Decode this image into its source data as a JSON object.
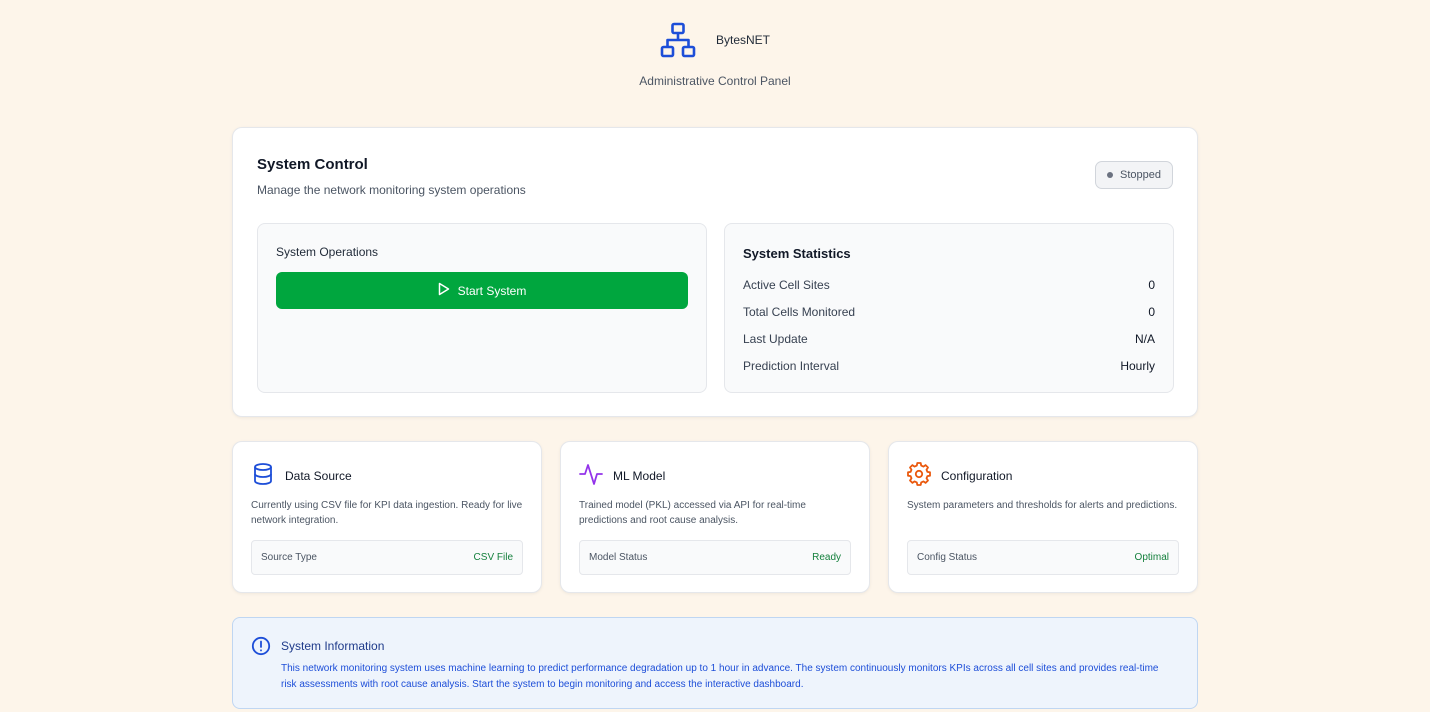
{
  "header": {
    "brand": "BytesNET",
    "subtitle": "Administrative Control Panel",
    "logo_icon": "network-hierarchy-icon",
    "accent_color": "#1d4ed8"
  },
  "system_control": {
    "title": "System Control",
    "description": "Manage the network monitoring system operations",
    "status": "Stopped",
    "operations": {
      "title": "System Operations",
      "start_button": "Start System",
      "button_color": "#00a63e"
    },
    "statistics": {
      "title": "System Statistics",
      "rows": [
        {
          "label": "Active Cell Sites",
          "value": "0"
        },
        {
          "label": "Total Cells Monitored",
          "value": "0"
        },
        {
          "label": "Last Update",
          "value": "N/A"
        },
        {
          "label": "Prediction Interval",
          "value": "Hourly"
        }
      ]
    }
  },
  "cards": [
    {
      "icon": "database-icon",
      "title": "Data Source",
      "description": "Currently using CSV file for KPI data ingestion. Ready for live network integration.",
      "row_label": "Source Type",
      "row_value": "CSV File"
    },
    {
      "icon": "activity-icon",
      "title": "ML Model",
      "description": "Trained model (PKL) accessed via API for real-time predictions and root cause analysis.",
      "row_label": "Model Status",
      "row_value": "Ready"
    },
    {
      "icon": "gear-icon",
      "title": "Configuration",
      "description": "System parameters and thresholds for alerts and predictions.",
      "row_label": "Config Status",
      "row_value": "Optimal"
    }
  ],
  "system_info": {
    "icon": "alert-circle-icon",
    "title": "System Information",
    "text": "This network monitoring system uses machine learning to predict performance degradation up to 1 hour in advance. The system continuously monitors KPIs across all cell sites and provides real-time risk assessments with root cause analysis. Start the system to begin monitoring and access the interactive dashboard."
  }
}
